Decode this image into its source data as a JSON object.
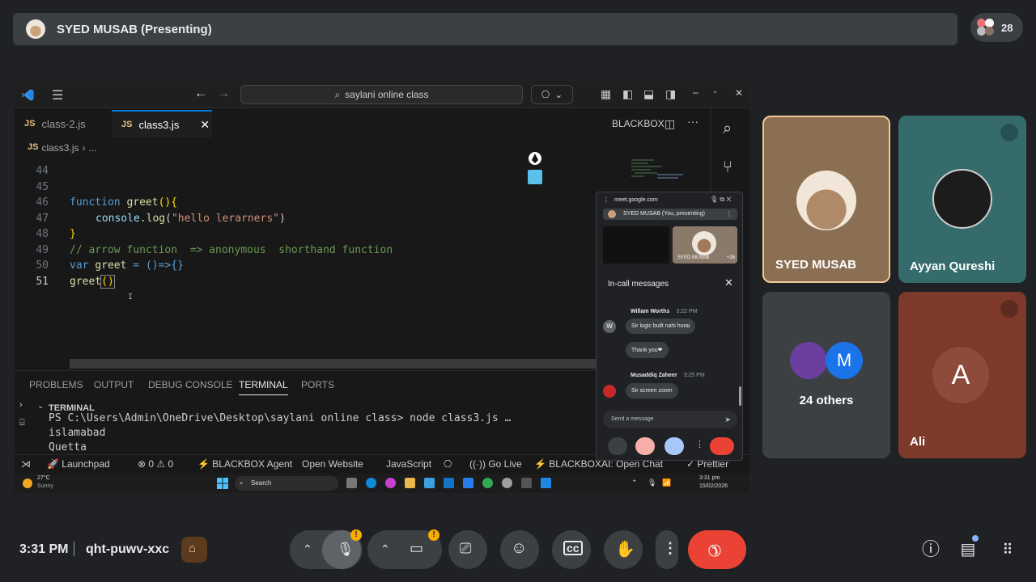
{
  "meet": {
    "presenter_banner": "SYED MUSAB (Presenting)",
    "participant_count": "28",
    "time": "3:31 PM",
    "meeting_code": "qht-puwv-xxc"
  },
  "tiles": [
    {
      "name": "SYED MUSAB"
    },
    {
      "name": "Ayyan Qureshi"
    },
    {
      "name": "24 others",
      "initial": "M"
    },
    {
      "name": "Ali",
      "initial": "A"
    }
  ],
  "vscode": {
    "search_placeholder": "saylani online class",
    "tabs": [
      {
        "icon": "JS",
        "label": "class-2.js"
      },
      {
        "icon": "JS",
        "label": "class3.js"
      }
    ],
    "blackbox_label": "BLACKBOX",
    "breadcrumb": {
      "icon": "JS",
      "file": "class3.js",
      "rest": "..."
    },
    "line_numbers": [
      "44",
      "45",
      "46",
      "47",
      "48",
      "49",
      "50",
      "51"
    ],
    "code_lines": {
      "l46_kw": "function",
      "l46_fn": "greet",
      "l46_rest": "(){",
      "l47_obj": "console",
      "l47_fn": ".log",
      "l47_p1": "(",
      "l47_str": "\"hello lerarners\"",
      "l47_p2": ")",
      "l48": "}",
      "l49": "// arrow function  => anonymous  shorthand function",
      "l50_kw": "var",
      "l50_var": "greet",
      "l50_rest": " = ()=>{}",
      "l51_fn": "greet",
      "l51_rest": "()"
    },
    "panel_tabs": [
      "PROBLEMS",
      "OUTPUT",
      "DEBUG CONSOLE",
      "TERMINAL",
      "PORTS"
    ],
    "terminal_header": "TERMINAL",
    "terminal_lines": [
      "PS C:\\Users\\Admin\\OneDrive\\Desktop\\saylani online class> node class3.js …",
      "islamabad",
      "Quetta"
    ],
    "status": {
      "launchpad": "Launchpad",
      "errors": "0",
      "warnings": "0",
      "agent": "BLACKBOX Agent",
      "open_website": "Open Website",
      "language": "JavaScript",
      "golive": "Go Live",
      "blackbox_chat": "BLACKBOXAI: Open Chat",
      "prettier": "Prettier"
    },
    "taskbar": {
      "temp": "27°C",
      "weather": "Sunny",
      "search": "Search",
      "time": "3:31 pm",
      "date": "15/02/2026"
    }
  },
  "mini_meet": {
    "url": "meet.google.com",
    "presenting": "SYED MUSAB (You, presenting)",
    "thumb_name": "SYED MUSAB",
    "thumb_more": "+26",
    "chat_title": "In-call messages",
    "messages": [
      {
        "avatar": "W",
        "name": "Willam Worths",
        "time": "3:22 PM",
        "texts": [
          "Sir logic built nahi horai",
          "Thank you❤"
        ]
      },
      {
        "avatar": "",
        "name": "Musaddiq Zaheer",
        "time": "3:25 PM",
        "texts": [
          "Sir screen zoom"
        ]
      }
    ],
    "send_placeholder": "Send a message"
  },
  "colors": {
    "accent_blue": "#8ab4f8",
    "end_call_red": "#ea4335",
    "warning": "#f9ab00"
  }
}
